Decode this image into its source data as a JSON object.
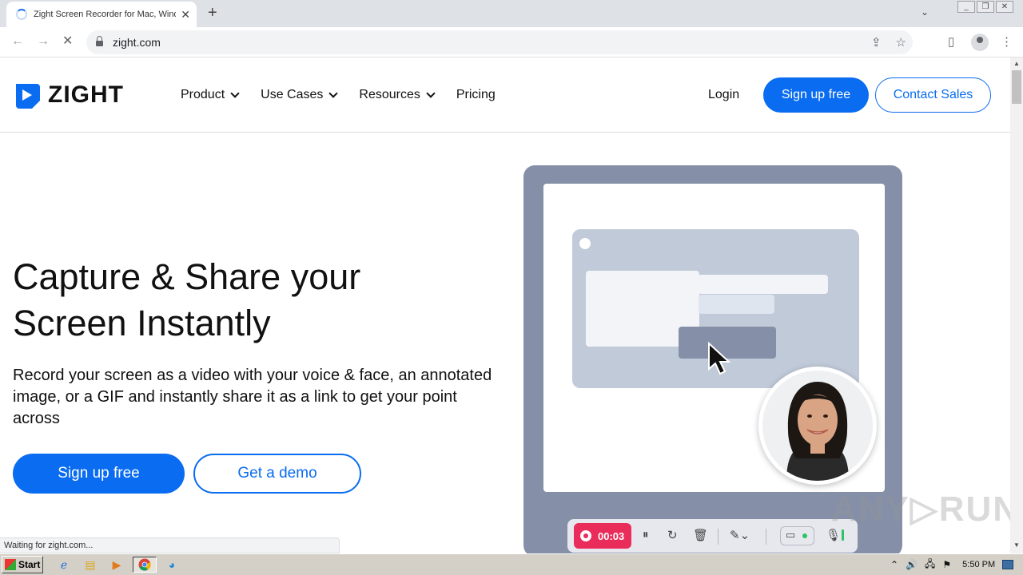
{
  "browser": {
    "tab_title": "Zight Screen Recorder for Mac, Windows",
    "tab_close": "✕",
    "new_tab": "+",
    "url": "zight.com",
    "status_text": "Waiting for zight.com..."
  },
  "header": {
    "logo_text": "ZIGHT",
    "nav": [
      {
        "label": "Product"
      },
      {
        "label": "Use Cases"
      },
      {
        "label": "Resources"
      },
      {
        "label": "Pricing"
      }
    ],
    "login": "Login",
    "signup": "Sign up free",
    "contact": "Contact Sales"
  },
  "hero": {
    "title": "Capture & Share your Screen Instantly",
    "subtitle": "Record your screen as a video with your voice & face, an annotated image, or a GIF and instantly share it as a link to get your point across",
    "primary_cta": "Sign up free",
    "secondary_cta": "Get a demo"
  },
  "recorder": {
    "timer": "00:03"
  },
  "watermark": "ANY▷RUN",
  "taskbar": {
    "start": "Start",
    "clock": "5:50 PM"
  },
  "colors": {
    "brand_blue": "#0a6cf0",
    "record_red": "#ea2c5a",
    "illustration_bg": "#8590a8"
  }
}
